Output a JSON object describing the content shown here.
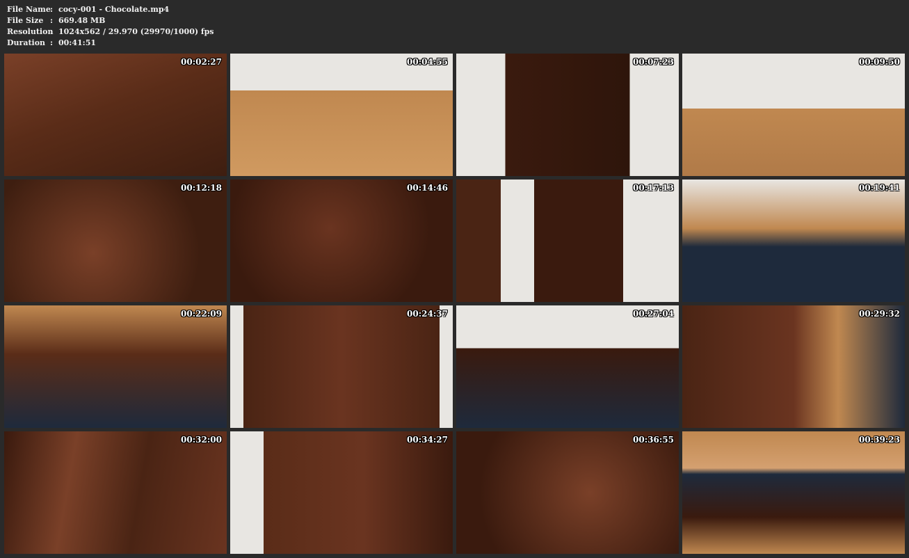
{
  "info": {
    "file_name": {
      "label": "File Name",
      "value": "cocy-001 - Chocolate.mp4"
    },
    "file_size": {
      "label": "File Size",
      "value": "669.48 MB"
    },
    "resolution": {
      "label": "Resolution",
      "value": "1024x562 / 29.970 (29970/1000) fps"
    },
    "duration": {
      "label": "Duration",
      "value": "00:41:51"
    },
    "separator": ":"
  },
  "thumbnails": [
    {
      "time": "00:02:27"
    },
    {
      "time": "00:04:55"
    },
    {
      "time": "00:07:23"
    },
    {
      "time": "00:09:50"
    },
    {
      "time": "00:12:18"
    },
    {
      "time": "00:14:46"
    },
    {
      "time": "00:17:13"
    },
    {
      "time": "00:19:41"
    },
    {
      "time": "00:22:09"
    },
    {
      "time": "00:24:37"
    },
    {
      "time": "00:27:04"
    },
    {
      "time": "00:29:32"
    },
    {
      "time": "00:32:00"
    },
    {
      "time": "00:34:27"
    },
    {
      "time": "00:36:55"
    },
    {
      "time": "00:39:23"
    }
  ],
  "colors": {
    "background": "#2a2a2a",
    "text": "#f0f0f0",
    "chocolate": "#4a2414",
    "chocolate_light": "#7a4028",
    "wall": "#e8e6e2",
    "floor": "#c08850",
    "container_blue": "#1e2a3c"
  }
}
